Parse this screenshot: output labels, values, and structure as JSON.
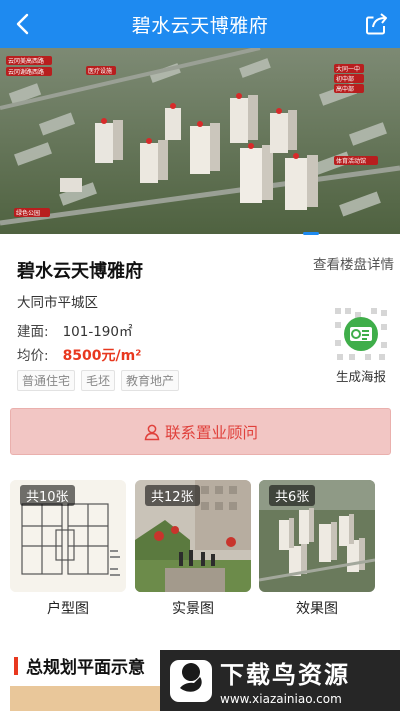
{
  "header": {
    "title": "碧水云天博雅府"
  },
  "hero": {
    "labels": [
      "云冈美高西路",
      "云冈谢路西路",
      "医疗设施",
      "大同一中",
      "初中部",
      "高中部",
      "绿色公园",
      "体育活动馆"
    ]
  },
  "property": {
    "name": "碧水云天博雅府",
    "detail_link": "查看楼盘详情",
    "district": "大同市平城区",
    "area_label": "建面:",
    "area_value": "101-190㎡",
    "price_label": "均价:",
    "price_value": "8500元/m²",
    "tags": [
      "普通住宅",
      "毛坯",
      "教育地产"
    ],
    "poster_label": "生成海报"
  },
  "contact": {
    "label": "联系置业顾问"
  },
  "gallery": [
    {
      "count": "共10张",
      "label": "户型图"
    },
    {
      "count": "共12张",
      "label": "实景图"
    },
    {
      "count": "共6张",
      "label": "效果图"
    }
  ],
  "section": {
    "title": "总规划平面示意"
  },
  "watermark": {
    "title": "下载鸟资源",
    "url": "www.xiazainiao.com"
  },
  "colors": {
    "header": "#1e8af0",
    "price": "#e8381f",
    "contact_bg": "#f2c6c4",
    "contact_text": "#e0413c",
    "poster_icon": "#3fae4a"
  }
}
